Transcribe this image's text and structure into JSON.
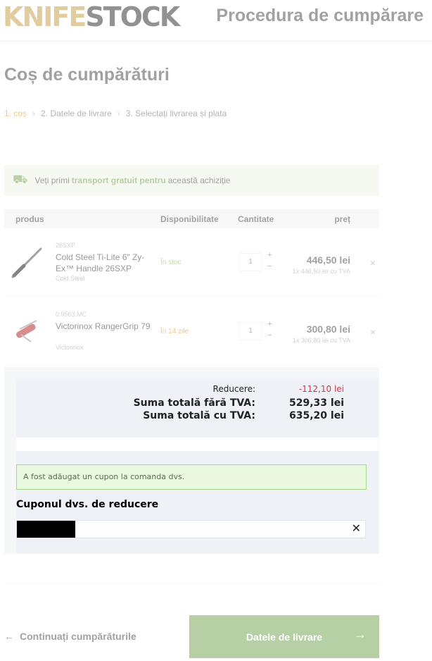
{
  "header": {
    "logo_part1": "KNIFE",
    "logo_part2": "STOCK",
    "title": "Procedura de cumpărare"
  },
  "page_title": "Coș de cumpărături",
  "steps": [
    {
      "num": "1.",
      "label": "coș"
    },
    {
      "num": "2.",
      "label": "Datele de livrare"
    },
    {
      "num": "3.",
      "label": "Selectați livrarea și plata"
    }
  ],
  "shipping": {
    "before": "Veți primi",
    "highlight": "transport gratuit pentru",
    "after": "această achiziție"
  },
  "table": {
    "headers": [
      "produs",
      "Disponibilitate",
      "Cantitate",
      "preț"
    ],
    "rows": [
      {
        "sku": "26SXP",
        "name": "Cold Steel Ti-Lite 6\" Zy-Ex™ Handle 26SXP",
        "brand": "Cold Steel",
        "availability": "În stoc",
        "qty": "1",
        "price": "446,50 lei",
        "price_sub": "1x 446,50 lei cu TVA"
      },
      {
        "sku": "0.9563.MC",
        "name": "Victorinox RangerGrip 79",
        "brand": "Victorinox",
        "availability": "În 14 zile",
        "qty": "1",
        "price": "300,80 lei",
        "price_sub": "1x 300,80 lei cu TVA"
      }
    ]
  },
  "totals": {
    "discount_label": "Reducere:",
    "discount_value": "-112,10 lei",
    "net_label": "Suma totală fără  TVA:",
    "net_value": "529,33 lei",
    "gross_label": "Suma totală cu TVA:",
    "gross_value": "635,20 lei"
  },
  "coupon": {
    "alert": "A fost adăugat un cupon la comanda dvs.",
    "title": "Cuponul dvs. de reducere",
    "clear_symbol": "✕"
  },
  "footer": {
    "continue": "Continuați cumpărăturile",
    "next": "Datele de livrare"
  },
  "colors": {
    "accent_green": "#7aa85a",
    "discount_red": "#e2304a",
    "logo_gold": "#c9a24d"
  }
}
